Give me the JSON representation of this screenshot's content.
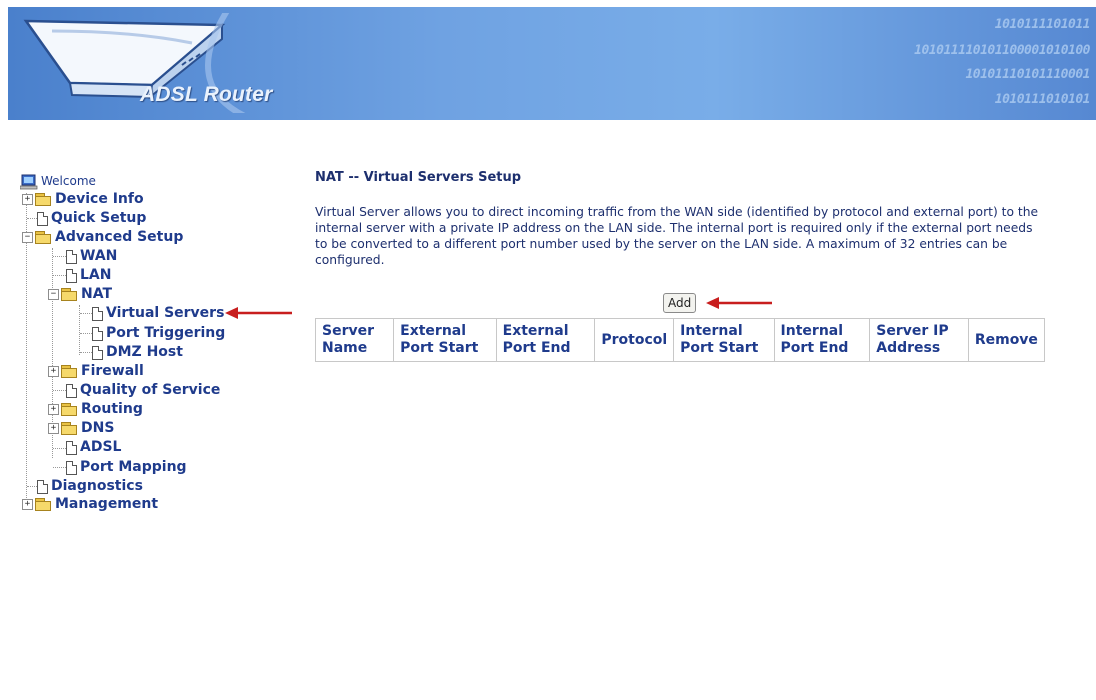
{
  "header": {
    "brand": "ADSL Router",
    "binary_rows": [
      "1010111101011",
      "101011110101100001010100",
      "10101110101110001",
      "1010111010101"
    ]
  },
  "sidebar": {
    "items": [
      {
        "label": "Welcome",
        "icon": "computer-icon"
      },
      {
        "label": "Device Info",
        "icon": "folder-icon",
        "expander": "+"
      },
      {
        "label": "Quick Setup",
        "icon": "page-icon"
      },
      {
        "label": "Advanced Setup",
        "icon": "open-folder-icon",
        "expander": "−"
      },
      {
        "label": "WAN",
        "icon": "page-icon"
      },
      {
        "label": "LAN",
        "icon": "page-icon"
      },
      {
        "label": "NAT",
        "icon": "open-folder-icon",
        "expander": "−"
      },
      {
        "label": "Virtual Servers",
        "icon": "page-icon",
        "selected": true
      },
      {
        "label": "Port Triggering",
        "icon": "page-icon"
      },
      {
        "label": "DMZ Host",
        "icon": "page-icon"
      },
      {
        "label": "Firewall",
        "icon": "folder-icon",
        "expander": "+"
      },
      {
        "label": "Quality of Service",
        "icon": "page-icon"
      },
      {
        "label": "Routing",
        "icon": "folder-icon",
        "expander": "+"
      },
      {
        "label": "DNS",
        "icon": "folder-icon",
        "expander": "+"
      },
      {
        "label": "ADSL",
        "icon": "page-icon"
      },
      {
        "label": "Port Mapping",
        "icon": "page-icon"
      },
      {
        "label": "Diagnostics",
        "icon": "page-icon"
      },
      {
        "label": "Management",
        "icon": "folder-icon",
        "expander": "+"
      }
    ]
  },
  "main": {
    "title": "NAT -- Virtual Servers Setup",
    "description": "Virtual Server allows you to direct incoming traffic from the WAN side (identified by protocol and external port) to the internal server with a private IP address on the LAN side. The internal port is required only if the external port needs to be converted to a different port number used by the server on the LAN side. A maximum of 32 entries can be configured.",
    "add_label": "Add",
    "table_headers": [
      "Server Name",
      "External Port Start",
      "External Port End",
      "Protocol",
      "Internal Port Start",
      "Internal Port End",
      "Server IP Address",
      "Remove"
    ]
  },
  "colors": {
    "banner": "#6fa2e2",
    "link_text": "#1f3b8c",
    "arrow": "#c81e1e"
  }
}
